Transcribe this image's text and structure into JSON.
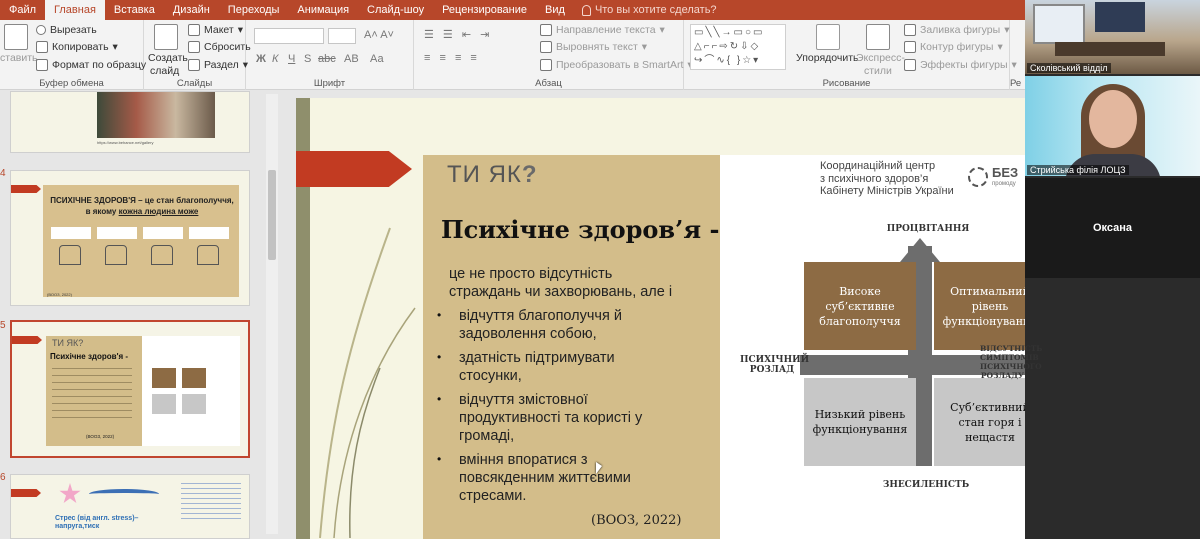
{
  "tabs": [
    {
      "label": "Файл",
      "active": false
    },
    {
      "label": "Главная",
      "active": true
    },
    {
      "label": "Вставка",
      "active": false
    },
    {
      "label": "Дизайн",
      "active": false
    },
    {
      "label": "Переходы",
      "active": false
    },
    {
      "label": "Анимация",
      "active": false
    },
    {
      "label": "Слайд-шоу",
      "active": false
    },
    {
      "label": "Рецензирование",
      "active": false
    },
    {
      "label": "Вид",
      "active": false
    }
  ],
  "tell_me": "Что вы хотите сделать?",
  "ribbon": {
    "clipboard": {
      "label": "Буфер обмена",
      "paste": "ставить",
      "cut": "Вырезать",
      "copy": "Копировать",
      "format_painter": "Формат по образцу"
    },
    "slides": {
      "label": "Слайды",
      "new_slide_1": "Создать",
      "new_slide_2": "слайд",
      "layout": "Макет",
      "reset": "Сбросить",
      "section": "Раздел"
    },
    "font": {
      "label": "Шрифт",
      "bold": "Ж",
      "italic": "К",
      "underline": "Ч",
      "strike": "S",
      "shadow": "abc",
      "spacing": "АВ",
      "case": "Аа"
    },
    "paragraph": {
      "label": "Абзац",
      "text_direction": "Направление текста",
      "align_text": "Выровнять текст",
      "smartart": "Преобразовать в SmartArt"
    },
    "drawing": {
      "label": "Рисование",
      "arrange": "Упорядочить",
      "express_1": "Экспресс-",
      "express_2": "стили",
      "fill": "Заливка фигуры",
      "outline": "Контур фигуры",
      "effects": "Эффекты фигуры"
    },
    "editing_label": "Ре"
  },
  "thumbs": [
    {
      "num": "",
      "caption": "https://www.behance.net/gallery"
    },
    {
      "num": "4",
      "title_line1": "ПСИХІЧНЕ ЗДОРОВ'Я – це стан благополуччя,",
      "title_line2_pre": "в якому ",
      "title_line2_u": "кожна людина може",
      "foot": "(ВООЗ, 2022)"
    },
    {
      "num": "5",
      "brand": "ТИ ЯК?",
      "title": "Психічне здоров'я -",
      "src": "(ВООЗ, 2022)"
    },
    {
      "num": "6",
      "title": "Стрес (від англ. stress)– напруга,тиск"
    }
  ],
  "slide": {
    "brand": "ТИ ЯК",
    "brand_q": "?",
    "title": "Психічне здоров’я -",
    "intro_1": "це не просто відсутність",
    "intro_2": "страждань чи захворювань, але і",
    "bullets": [
      [
        "відчуття благополуччя й",
        "задоволення собою,"
      ],
      [
        "здатність підтримувати",
        "стосунки,"
      ],
      [
        "відчуття змістовної",
        "продуктивності та користі у",
        "громаді,"
      ],
      [
        "вміння впоратися з",
        "повсякденним життєвими",
        "стресами."
      ]
    ],
    "bullet_char": "•",
    "source": "(ВООЗ, 2022)",
    "org": [
      "Координаційний центр",
      "з психічного здоров’я",
      "Кабінету Міністрів України"
    ],
    "logo": "БЕЗ",
    "logo_sub": "промоду",
    "axis_top": "ПРОЦВІТАННЯ",
    "axis_bottom": "ЗНЕСИЛЕНІСТЬ",
    "axis_left": [
      "ПСИХІЧНИЙ",
      "РОЗЛАД"
    ],
    "axis_right": [
      "ВІДСУТНІСТЬ",
      "СИМПТОМІВ",
      "ПСИХІЧНОГО",
      "РОЗЛАДУ"
    ],
    "quadrants": {
      "tl": [
        "Високе",
        "суб’єктивне",
        "благополуччя"
      ],
      "tr": [
        "Оптимальний",
        "рівень",
        "функціонування"
      ],
      "bl": [
        "Низький рівень",
        "функціонування"
      ],
      "br": [
        "Суб’єктивний",
        "стан горя і",
        "нещастя"
      ]
    }
  },
  "video": [
    {
      "label": "Сколівський відділ"
    },
    {
      "label": "Стрийська філія ЛОЦЗ"
    },
    {
      "label": "Оксана"
    }
  ]
}
